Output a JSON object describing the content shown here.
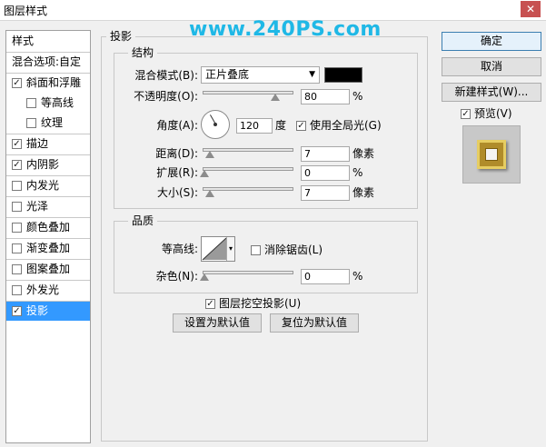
{
  "window": {
    "title": "图层样式",
    "close_glyph": "✕"
  },
  "watermark": "www.240PS.com",
  "left_panel": {
    "header": "样式",
    "blend_options": "混合选项:自定",
    "items": [
      {
        "label": "斜面和浮雕",
        "checked": true
      },
      {
        "label": "等高线",
        "checked": false
      },
      {
        "label": "纹理",
        "checked": false
      },
      {
        "label": "描边",
        "checked": true
      },
      {
        "label": "内阴影",
        "checked": true
      },
      {
        "label": "内发光",
        "checked": false
      },
      {
        "label": "光泽",
        "checked": false
      },
      {
        "label": "颜色叠加",
        "checked": false
      },
      {
        "label": "渐变叠加",
        "checked": false
      },
      {
        "label": "图案叠加",
        "checked": false
      },
      {
        "label": "外发光",
        "checked": false
      },
      {
        "label": "投影",
        "checked": true,
        "selected": true
      }
    ]
  },
  "drop_shadow": {
    "title": "投影",
    "structure": {
      "title": "结构",
      "blend_mode_label": "混合模式(B):",
      "blend_mode_value": "正片叠底",
      "shadow_color": "#000000",
      "opacity_label": "不透明度(O):",
      "opacity_value": "80",
      "opacity_level": 0.8,
      "opacity_unit": "%",
      "angle_label": "角度(A):",
      "angle_value": "120",
      "angle_unit": "度",
      "global_light_label": "使用全局光(G)",
      "global_light_checked": true,
      "distance_label": "距离(D):",
      "distance_value": "7",
      "distance_unit": "像素",
      "spread_label": "扩展(R):",
      "spread_value": "0",
      "spread_unit": "%",
      "size_label": "大小(S):",
      "size_value": "7",
      "size_unit": "像素"
    },
    "quality": {
      "title": "品质",
      "contour_label": "等高线:",
      "antialias_label": "消除锯齿(L)",
      "antialias_checked": false,
      "noise_label": "杂色(N):",
      "noise_value": "0",
      "noise_unit": "%"
    },
    "knockout_label": "图层挖空投影(U)",
    "knockout_checked": true,
    "make_default": "设置为默认值",
    "reset_default": "复位为默认值"
  },
  "right_buttons": {
    "ok": "确定",
    "cancel": "取消",
    "new_style": "新建样式(W)...",
    "preview_label": "预览(V)",
    "preview_checked": true
  },
  "colors": {
    "selection": "#3399ff",
    "watermark": "#1fb8e6",
    "shadow": "#000000"
  }
}
